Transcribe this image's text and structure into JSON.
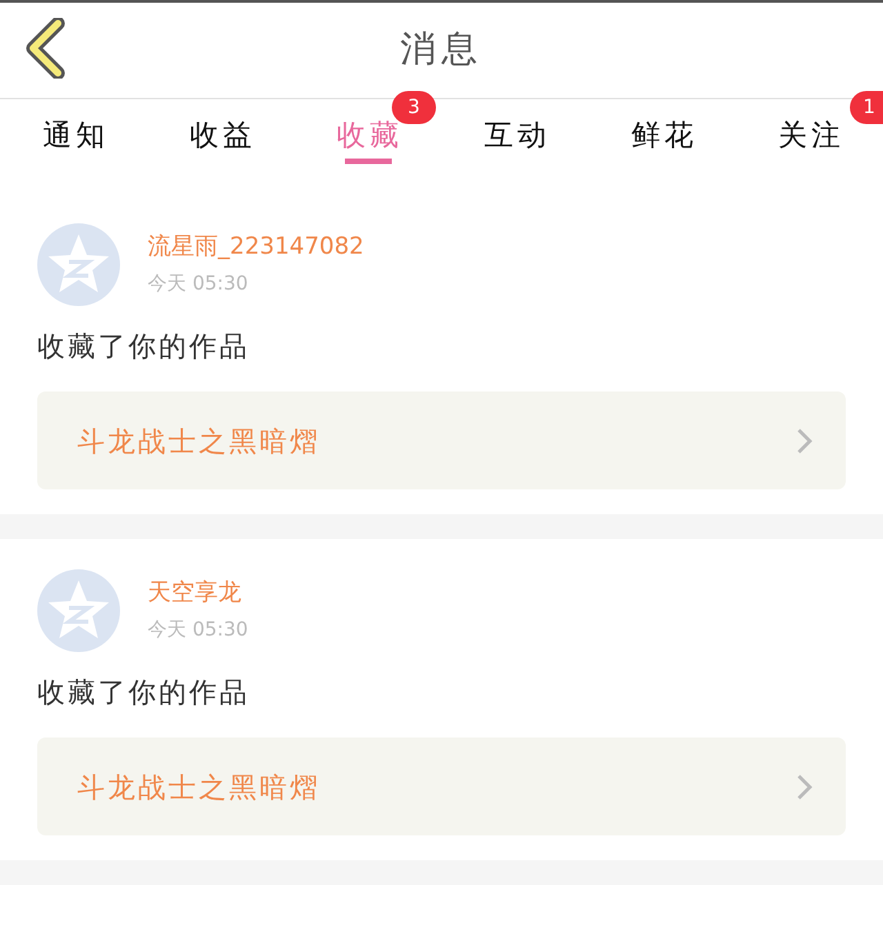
{
  "header": {
    "title": "消息"
  },
  "tabs": [
    {
      "label": "通知",
      "selected": false
    },
    {
      "label": "收益",
      "selected": false
    },
    {
      "label": "收藏",
      "selected": true,
      "badge": "3"
    },
    {
      "label": "互动",
      "selected": false
    },
    {
      "label": "鲜花",
      "selected": false
    },
    {
      "label": "关注",
      "selected": false,
      "badge": "1"
    }
  ],
  "messages": [
    {
      "user": "流星雨_223147082",
      "time": "今天 05:30",
      "action": "收藏了你的作品",
      "work": "斗龙战士之黑暗熠"
    },
    {
      "user": "天空享龙",
      "time": "今天 05:30",
      "action": "收藏了你的作品",
      "work": "斗龙战士之黑暗熠"
    }
  ]
}
